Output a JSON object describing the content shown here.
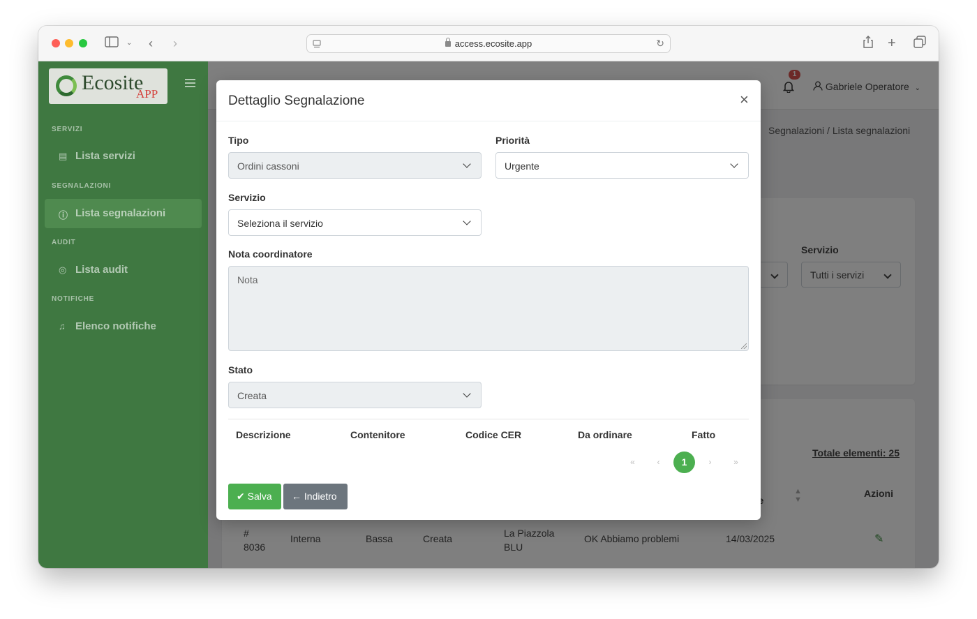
{
  "browser": {
    "url": "access.ecosite.app"
  },
  "sidebar": {
    "logo_text": "Ecosite",
    "logo_suffix": "APP",
    "sections": [
      {
        "header": "SERVIZI",
        "item": "Lista servizi",
        "icon": "building-icon"
      },
      {
        "header": "SEGNALAZIONI",
        "item": "Lista segnalazioni",
        "icon": "alert-circle-icon"
      },
      {
        "header": "AUDIT",
        "item": "Lista audit",
        "icon": "eye-icon"
      },
      {
        "header": "NOTIFICHE",
        "item": "Elenco notifiche",
        "icon": "bell-icon"
      }
    ]
  },
  "topbar": {
    "notification_count": "1",
    "user_name": "Gabriele Operatore"
  },
  "background": {
    "breadcrumb": "Segnalazioni  /  Lista segnalazioni",
    "filter_label": "Servizio",
    "filter_value": "Tutti i servizi",
    "total": "Totale elementi: 25",
    "actions_header": "Azioni",
    "partial_header": "ne",
    "row": {
      "id": "# 8036",
      "type": "Interna",
      "priority": "Bassa",
      "state": "Creata",
      "service": "La Piazzola BLU",
      "note": "OK Abbiamo problemi",
      "date": "14/03/2025"
    }
  },
  "modal": {
    "title": "Dettaglio Segnalazione",
    "close": "×",
    "tipo_label": "Tipo",
    "tipo_value": "Ordini cassoni",
    "priorita_label": "Priorità",
    "priorita_value": "Urgente",
    "servizio_label": "Servizio",
    "servizio_value": "Seleziona il servizio",
    "nota_label": "Nota coordinatore",
    "nota_placeholder": "Nota",
    "stato_label": "Stato",
    "stato_value": "Creata",
    "table_headers": [
      "Descrizione",
      "Contenitore",
      "Codice CER",
      "Da ordinare",
      "Fatto"
    ],
    "pagination": {
      "first": "«",
      "prev": "‹",
      "current": "1",
      "next": "›",
      "last": "»"
    },
    "save_label": "Salva",
    "back_label": "Indietro"
  }
}
